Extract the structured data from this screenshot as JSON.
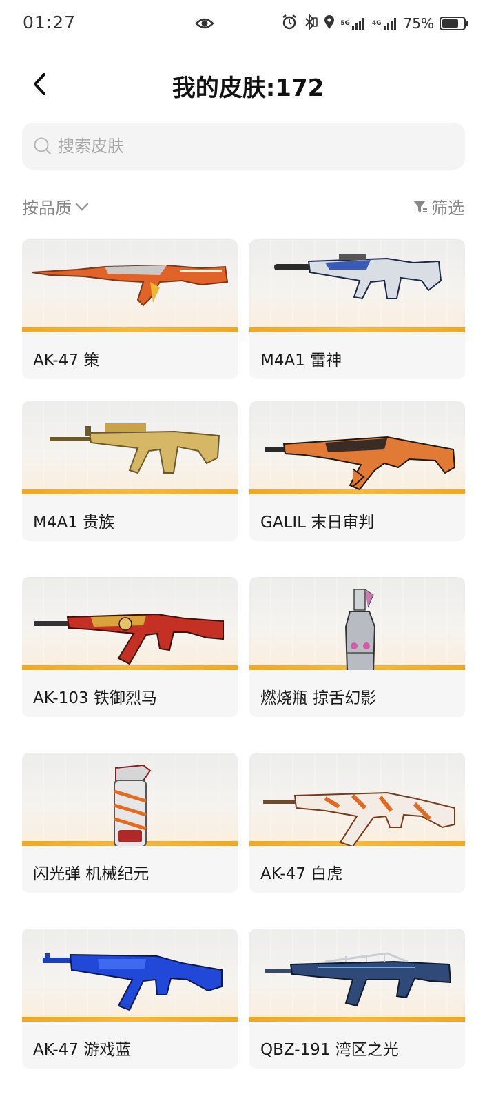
{
  "status_bar": {
    "time": "01:27",
    "net1": "5G",
    "net2": "4G",
    "battery": "75%",
    "battery_level": 0.75
  },
  "header": {
    "title": "我的皮肤:172"
  },
  "search": {
    "placeholder": "搜索皮肤"
  },
  "filters": {
    "sort_label": "按品质",
    "filter_label": "筛选"
  },
  "colors": {
    "quality_bar": "#f2a81f",
    "card_bg": "#f6f6f7"
  },
  "skins": [
    {
      "name": "AK-47 策",
      "icon": "rifle-orange-icon"
    },
    {
      "name": "M4A1 雷神",
      "icon": "rifle-silver-blue-icon"
    },
    {
      "name": "M4A1 贵族",
      "icon": "rifle-gold-icon"
    },
    {
      "name": "GALIL 末日审判",
      "icon": "rifle-orange-black-icon"
    },
    {
      "name": "AK-103 铁御烈马",
      "icon": "rifle-red-icon"
    },
    {
      "name": "燃烧瓶 掠舌幻影",
      "icon": "molotov-icon"
    },
    {
      "name": "闪光弹 机械纪元",
      "icon": "flashbang-icon"
    },
    {
      "name": "AK-47 白虎",
      "icon": "rifle-white-tiger-icon"
    },
    {
      "name": "AK-47 游戏蓝",
      "icon": "rifle-blue-icon"
    },
    {
      "name": "QBZ-191 湾区之光",
      "icon": "rifle-navy-icon"
    }
  ]
}
